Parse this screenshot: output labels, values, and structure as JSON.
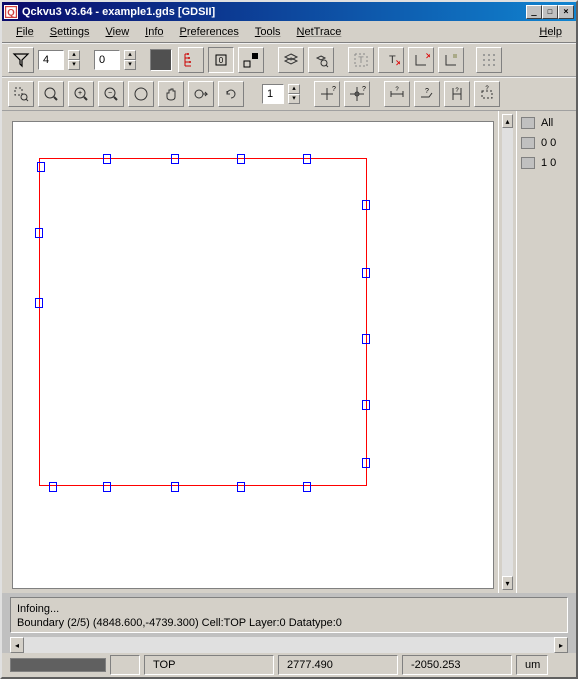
{
  "title": "Qckvu3 v3.64 - example1.gds [GDSII]",
  "menu": {
    "file": "File",
    "settings": "Settings",
    "view": "View",
    "info": "Info",
    "preferences": "Preferences",
    "tools": "Tools",
    "nettrace": "NetTrace",
    "help": "Help"
  },
  "toolbar1": {
    "level_value": "4",
    "filter_value": "0"
  },
  "toolbar2": {
    "scale_value": "1"
  },
  "layers": {
    "all": "All",
    "layer0": "0 0",
    "layer1": "1 0"
  },
  "info": {
    "line1": "Infoing...",
    "line2": "Boundary (2/5) (4848.600,-4739.300) Cell:TOP Layer:0 Datatype:0"
  },
  "status": {
    "cell": "TOP",
    "x": "2777.490",
    "y": "-2050.253",
    "unit": "um"
  },
  "colors": {
    "boundary": "#ff0000",
    "marker": "#0000ff"
  }
}
